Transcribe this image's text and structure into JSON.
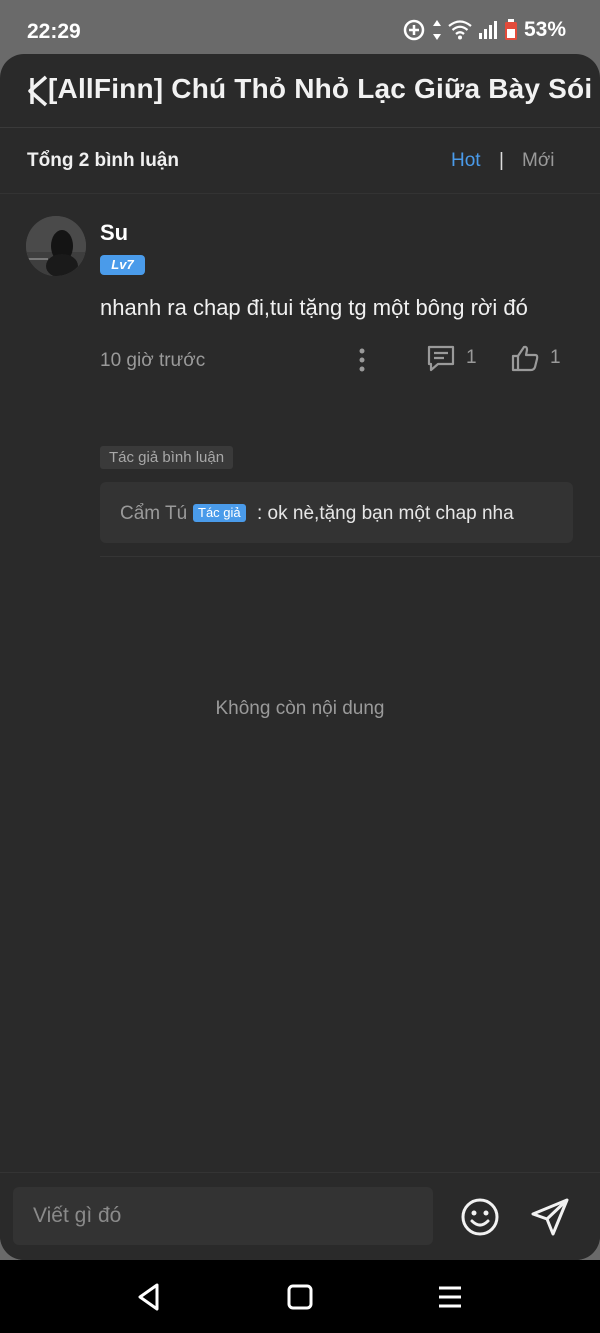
{
  "status_bar": {
    "time": "22:29",
    "battery": "53%"
  },
  "header": {
    "title": "[AllFinn] Chú Thỏ Nhỏ Lạc Giữa Bày Sói"
  },
  "sort": {
    "total_label": "Tổng 2 bình luận",
    "hot_label": "Hot",
    "separator": "|",
    "new_label": "Mới",
    "active": "Hot"
  },
  "comment": {
    "username": "Su",
    "level": "Lv7",
    "text": "nhanh ra chap đi,tui tặng tg một bông rời đó",
    "time": "10 giờ trước",
    "reply_count": "1",
    "like_count": "1",
    "author_commented_tag": "Tác giả bình luận",
    "reply": {
      "author": "Cẩm Tú",
      "author_badge": "Tác giả",
      "text": ": ok nè,tặng bạn một chap nha"
    }
  },
  "end_text": "Không còn nội dung",
  "input": {
    "placeholder": "Viết gì đó"
  },
  "colors": {
    "accent": "#4a9bea",
    "background": "#2a2a2a",
    "status_bar": "#6a6a6a"
  }
}
